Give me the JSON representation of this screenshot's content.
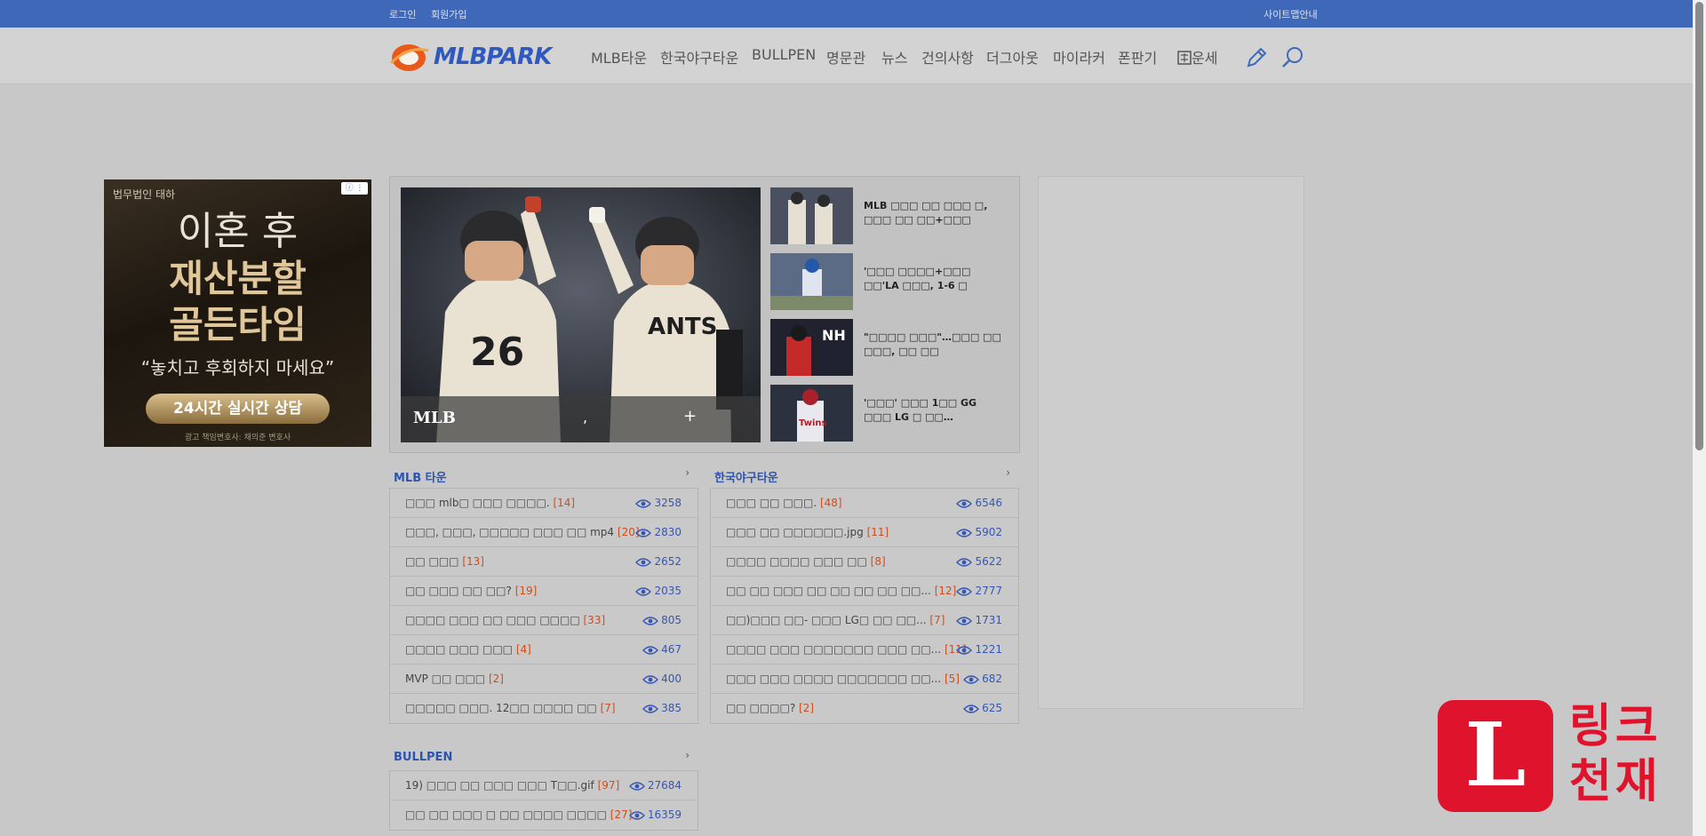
{
  "topbar": {
    "left1": "로그인",
    "left2": "회원가입",
    "right": "사이트맵안내"
  },
  "header": {
    "logo_text": "MLBPARK",
    "nav": [
      "MLB타운",
      "한국야구타운",
      "BULLPEN",
      "명문관",
      "뉴스",
      "건의사항",
      "더그아웃",
      "마이라커",
      "폰판기",
      "운세"
    ]
  },
  "left_ad": {
    "firm": "법무법인 태하",
    "line1": "이혼 후",
    "line2": "재산분할",
    "line3": "골든타임",
    "line4": "“놓치고 후회하지 마세요”",
    "button": "24시간 실시간 상담",
    "footer": "광고 책임변호사: 채의준 변호사",
    "info_badge": "ⓘ ⋮"
  },
  "feature": {
    "caption_title": "MLB",
    "caption_comma": ",",
    "caption_plus": "+",
    "items": [
      {
        "text": "MLB □□□ □□ □□□ □, □□□ □□ □□+□□□"
      },
      {
        "text": "'□□□ □□□□+□□□ □□'LA □□□, 1-6 □"
      },
      {
        "text": "\"□□□□ □□□\"…□□□ □□ □□□, □□ □□"
      },
      {
        "text": "'□□□' □□□ 1□□ GG □□□ LG □ □□…"
      }
    ]
  },
  "boards": {
    "mlb": {
      "title": "MLB 타운",
      "more": "›",
      "rows": [
        {
          "title": "□□□ mlb□ □□□ □□□□.",
          "comments": "[14]",
          "views": "3258"
        },
        {
          "title": "□□□, □□□, □□□□□ □□□ □□ mp4",
          "comments": "[20]",
          "views": "2830"
        },
        {
          "title": "□□ □□□",
          "comments": "[13]",
          "views": "2652"
        },
        {
          "title": "□□ □□□ □□ □□?",
          "comments": "[19]",
          "views": "2035"
        },
        {
          "title": "□□□□ □□□ □□ □□□ □□□□",
          "comments": "[33]",
          "views": "805"
        },
        {
          "title": "□□□□ □□□ □□□",
          "comments": "[4]",
          "views": "467"
        },
        {
          "title": "MVP □□ □□□",
          "comments": "[2]",
          "views": "400"
        },
        {
          "title": "□□□□□ □□□. 12□□ □□□□ □□",
          "comments": "[7]",
          "views": "385"
        }
      ]
    },
    "korea": {
      "title": "한국야구타운",
      "more": "›",
      "rows": [
        {
          "title": "□□□ □□ □□□.",
          "comments": "[48]",
          "views": "6546"
        },
        {
          "title": "□□□ □□ □□□□□□.jpg",
          "comments": "[11]",
          "views": "5902"
        },
        {
          "title": "□□□□ □□□□ □□□ □□",
          "comments": "[8]",
          "views": "5622"
        },
        {
          "title": "□□ □□ □□□ □□ □□ □□ □□ □□...",
          "comments": "[12]",
          "views": "2777"
        },
        {
          "title": "□□)□□□ □□- □□□ LG□ □□ □□...",
          "comments": "[7]",
          "views": "1731"
        },
        {
          "title": "□□□□ □□□ □□□□□□□ □□□ □□...",
          "comments": "[11]",
          "views": "1221"
        },
        {
          "title": "□□□ □□□ □□□□ □□□□□□□ □□...",
          "comments": "[5]",
          "views": "682"
        },
        {
          "title": "□□ □□□□?",
          "comments": "[2]",
          "views": "625"
        }
      ]
    },
    "bullpen": {
      "title": "BULLPEN",
      "more": "›",
      "rows": [
        {
          "title": "19) □□□ □□ □□□ □□□ T□□.gif",
          "comments": "[97]",
          "views": "27684"
        },
        {
          "title": "□□ □□ □□□ □ □□ □□□□ □□□□",
          "comments": "[27]",
          "views": "16359"
        }
      ]
    }
  },
  "watermark": {
    "letter": "L",
    "line1": "링크",
    "line2": "천재"
  },
  "colors": {
    "topbar": "#3f68b8",
    "accent_blue": "#2c55b0",
    "comment_orange": "#d04c1c",
    "watermark_red": "#e0132c"
  }
}
